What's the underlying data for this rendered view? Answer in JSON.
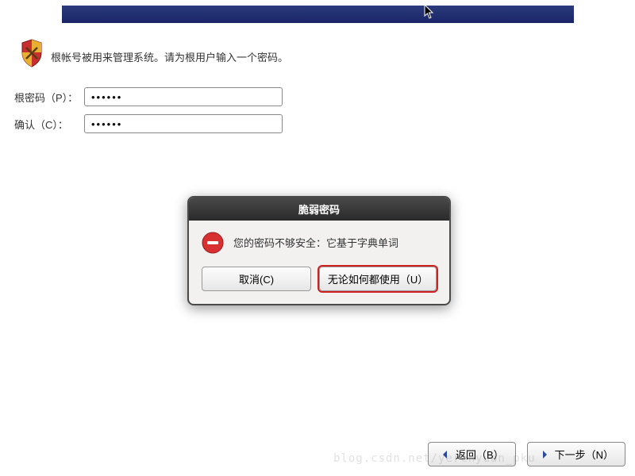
{
  "instruction": "根帐号被用来管理系统。请为根用户输入一个密码。",
  "form": {
    "password_label": "根密码（P）：",
    "password_value": "••••••",
    "confirm_label": "确认（C）：",
    "confirm_value": "••••••"
  },
  "dialog": {
    "title": "脆弱密码",
    "message": "您的密码不够安全：它基于字典单词",
    "cancel_label": "取消(C)",
    "use_label": "无论如何都使用（U）"
  },
  "footer": {
    "back_label": "返回（B）",
    "next_label": "下一步（N）"
  },
  "watermark": "blog.csdn.net/yerenyuan_pku"
}
